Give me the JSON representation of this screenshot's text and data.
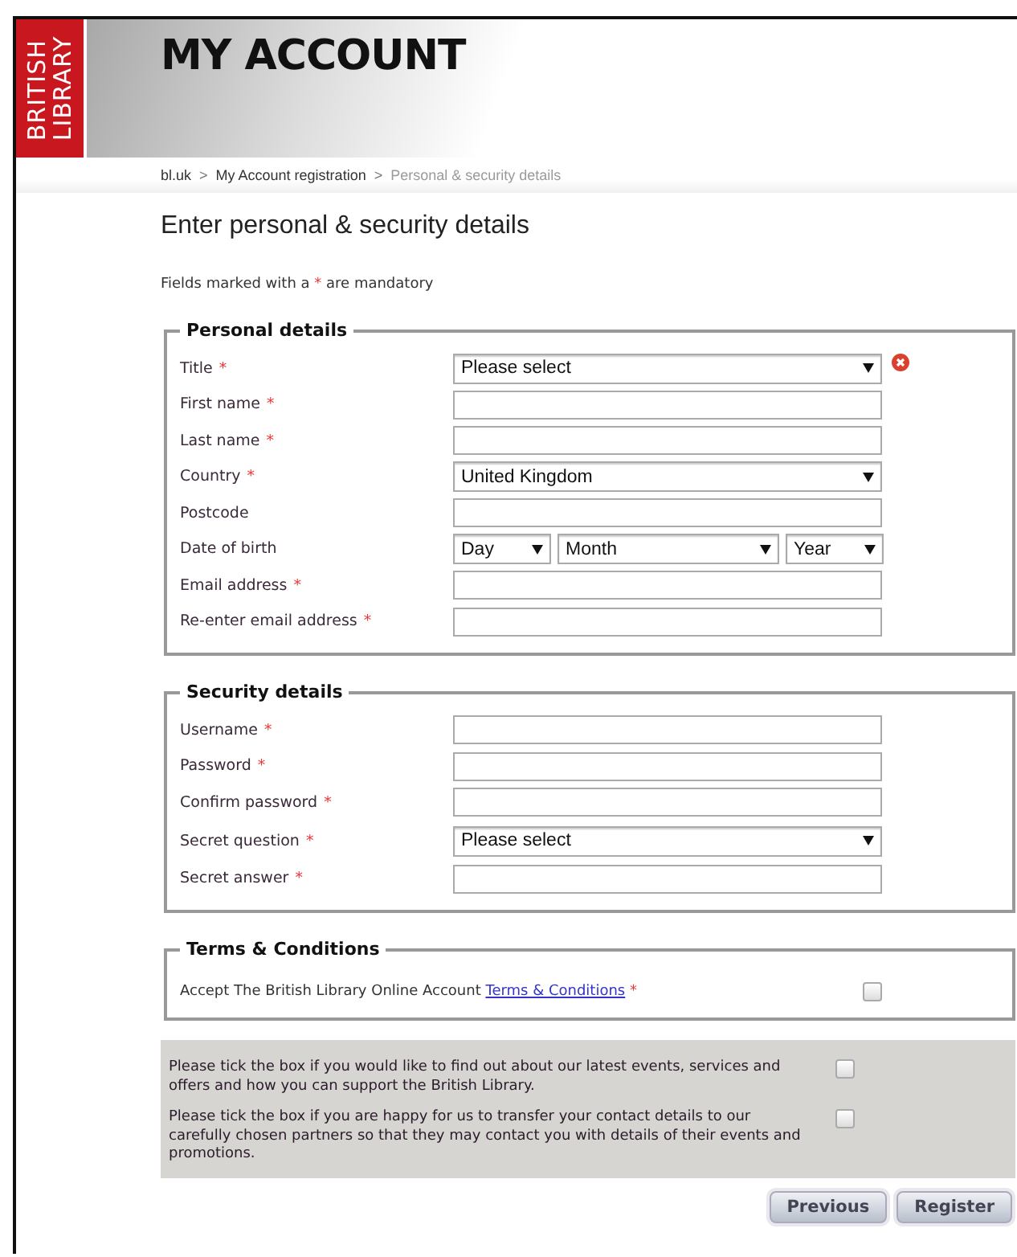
{
  "logo": {
    "lines": [
      "BRITISH",
      "LIBRARY"
    ]
  },
  "header": {
    "title": "MY ACCOUNT"
  },
  "breadcrumb": {
    "items": [
      {
        "label": "bl.uk",
        "current": false
      },
      {
        "label": "My Account registration",
        "current": false
      },
      {
        "label": "Personal & security details",
        "current": true
      }
    ],
    "separators": [
      ">",
      ">"
    ]
  },
  "heading": "Enter personal & security details",
  "mandatory_note": {
    "before": "Fields marked with a",
    "mark": "*",
    "after": "are mandatory"
  },
  "sections": [
    {
      "legend": "Personal details",
      "fields": [
        {
          "label": "Title",
          "mark": "*",
          "kind": "select",
          "value": "Please select",
          "error": true
        },
        {
          "label": "First name",
          "mark": "*",
          "kind": "text",
          "error": false
        },
        {
          "label": "Last name",
          "mark": "*",
          "kind": "text",
          "error": false
        },
        {
          "label": "Country",
          "mark": "*",
          "kind": "select",
          "value": "United Kingdom",
          "error": false
        },
        {
          "label": "Postcode",
          "kind": "text",
          "error": false
        },
        {
          "label": "Date of birth",
          "kind": "date",
          "parts": [
            "Day",
            "Month",
            "Year"
          ],
          "error": false
        },
        {
          "label": "Email address",
          "mark": "*",
          "kind": "text",
          "error": false
        },
        {
          "label": "Re-enter email address",
          "mark": "*",
          "kind": "text",
          "error": false
        }
      ]
    },
    {
      "legend": "Security details",
      "fields": [
        {
          "label": "Username",
          "mark": "*",
          "kind": "text",
          "error": false
        },
        {
          "label": "Password",
          "mark": "*",
          "kind": "text",
          "error": false
        },
        {
          "label": "Confirm password",
          "mark": "*",
          "kind": "text",
          "error": false
        },
        {
          "label": "Secret question",
          "mark": "*",
          "kind": "select",
          "value": "Please select",
          "error": false
        },
        {
          "label": "Secret answer",
          "mark": "*",
          "kind": "text",
          "error": false
        }
      ]
    }
  ],
  "terms": {
    "legend": "Terms & Conditions",
    "before": "Accept The British Library Online Account",
    "link": "Terms & Conditions",
    "mark": "*",
    "checked": false
  },
  "options": [
    {
      "text": "Please tick the box if you would like to find out about our latest events, services and offers and how you can support the British Library.",
      "checked": false
    },
    {
      "text": "Please tick the box if you are happy for us to transfer your contact details to our carefully chosen partners so that they may contact you with details of their events and promotions.",
      "checked": false
    }
  ],
  "buttons": [
    "Previous",
    "Register"
  ]
}
